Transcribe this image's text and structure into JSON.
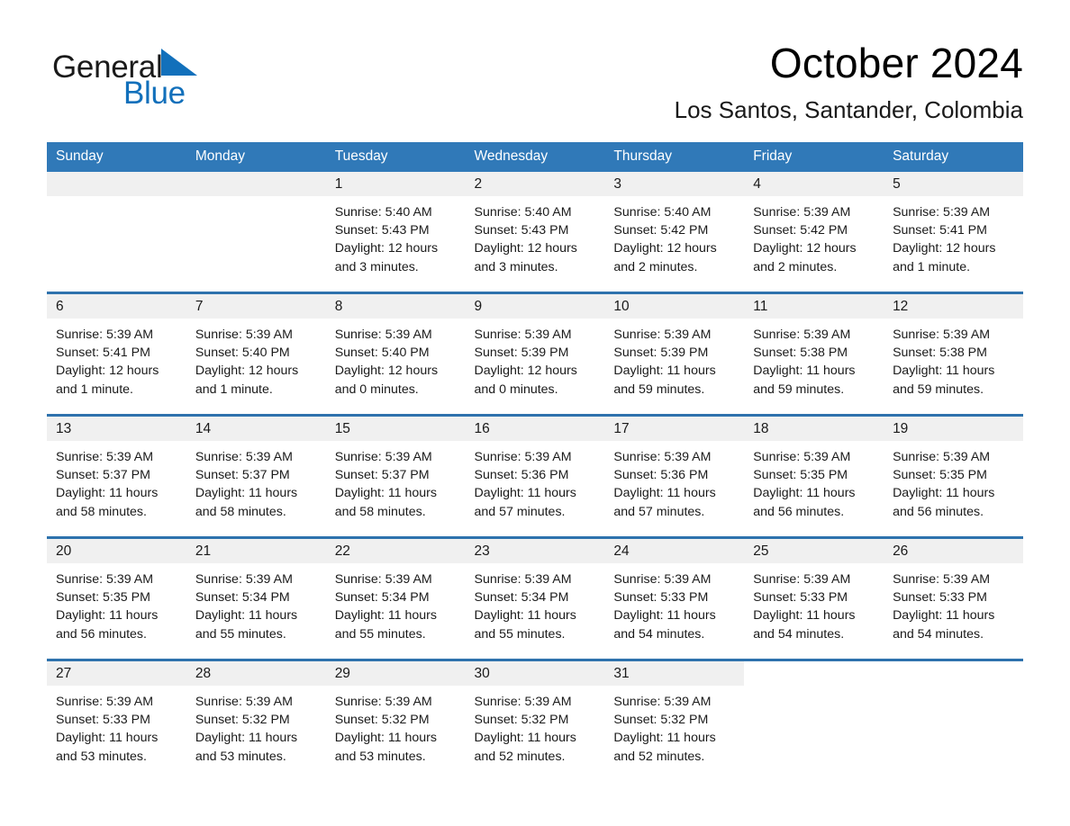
{
  "brand": {
    "word1": "General",
    "word2": "Blue",
    "flag_icon": "blue-triangle-flag",
    "accent_color": "#1270bb"
  },
  "header": {
    "month_title": "October 2024",
    "location": "Los Santos, Santander, Colombia"
  },
  "theme": {
    "header_blue": "#3079b8",
    "row_rule_blue": "#2e72ad",
    "daynum_band": "#f0f0f0"
  },
  "calendar": {
    "weekday_headers": [
      "Sunday",
      "Monday",
      "Tuesday",
      "Wednesday",
      "Thursday",
      "Friday",
      "Saturday"
    ],
    "weeks": [
      [
        {
          "day": "",
          "empty": true
        },
        {
          "day": "",
          "empty": true
        },
        {
          "day": "1",
          "sunrise": "Sunrise: 5:40 AM",
          "sunset": "Sunset: 5:43 PM",
          "daylight1": "Daylight: 12 hours",
          "daylight2": "and 3 minutes."
        },
        {
          "day": "2",
          "sunrise": "Sunrise: 5:40 AM",
          "sunset": "Sunset: 5:43 PM",
          "daylight1": "Daylight: 12 hours",
          "daylight2": "and 3 minutes."
        },
        {
          "day": "3",
          "sunrise": "Sunrise: 5:40 AM",
          "sunset": "Sunset: 5:42 PM",
          "daylight1": "Daylight: 12 hours",
          "daylight2": "and 2 minutes."
        },
        {
          "day": "4",
          "sunrise": "Sunrise: 5:39 AM",
          "sunset": "Sunset: 5:42 PM",
          "daylight1": "Daylight: 12 hours",
          "daylight2": "and 2 minutes."
        },
        {
          "day": "5",
          "sunrise": "Sunrise: 5:39 AM",
          "sunset": "Sunset: 5:41 PM",
          "daylight1": "Daylight: 12 hours",
          "daylight2": "and 1 minute."
        }
      ],
      [
        {
          "day": "6",
          "sunrise": "Sunrise: 5:39 AM",
          "sunset": "Sunset: 5:41 PM",
          "daylight1": "Daylight: 12 hours",
          "daylight2": "and 1 minute."
        },
        {
          "day": "7",
          "sunrise": "Sunrise: 5:39 AM",
          "sunset": "Sunset: 5:40 PM",
          "daylight1": "Daylight: 12 hours",
          "daylight2": "and 1 minute."
        },
        {
          "day": "8",
          "sunrise": "Sunrise: 5:39 AM",
          "sunset": "Sunset: 5:40 PM",
          "daylight1": "Daylight: 12 hours",
          "daylight2": "and 0 minutes."
        },
        {
          "day": "9",
          "sunrise": "Sunrise: 5:39 AM",
          "sunset": "Sunset: 5:39 PM",
          "daylight1": "Daylight: 12 hours",
          "daylight2": "and 0 minutes."
        },
        {
          "day": "10",
          "sunrise": "Sunrise: 5:39 AM",
          "sunset": "Sunset: 5:39 PM",
          "daylight1": "Daylight: 11 hours",
          "daylight2": "and 59 minutes."
        },
        {
          "day": "11",
          "sunrise": "Sunrise: 5:39 AM",
          "sunset": "Sunset: 5:38 PM",
          "daylight1": "Daylight: 11 hours",
          "daylight2": "and 59 minutes."
        },
        {
          "day": "12",
          "sunrise": "Sunrise: 5:39 AM",
          "sunset": "Sunset: 5:38 PM",
          "daylight1": "Daylight: 11 hours",
          "daylight2": "and 59 minutes."
        }
      ],
      [
        {
          "day": "13",
          "sunrise": "Sunrise: 5:39 AM",
          "sunset": "Sunset: 5:37 PM",
          "daylight1": "Daylight: 11 hours",
          "daylight2": "and 58 minutes."
        },
        {
          "day": "14",
          "sunrise": "Sunrise: 5:39 AM",
          "sunset": "Sunset: 5:37 PM",
          "daylight1": "Daylight: 11 hours",
          "daylight2": "and 58 minutes."
        },
        {
          "day": "15",
          "sunrise": "Sunrise: 5:39 AM",
          "sunset": "Sunset: 5:37 PM",
          "daylight1": "Daylight: 11 hours",
          "daylight2": "and 58 minutes."
        },
        {
          "day": "16",
          "sunrise": "Sunrise: 5:39 AM",
          "sunset": "Sunset: 5:36 PM",
          "daylight1": "Daylight: 11 hours",
          "daylight2": "and 57 minutes."
        },
        {
          "day": "17",
          "sunrise": "Sunrise: 5:39 AM",
          "sunset": "Sunset: 5:36 PM",
          "daylight1": "Daylight: 11 hours",
          "daylight2": "and 57 minutes."
        },
        {
          "day": "18",
          "sunrise": "Sunrise: 5:39 AM",
          "sunset": "Sunset: 5:35 PM",
          "daylight1": "Daylight: 11 hours",
          "daylight2": "and 56 minutes."
        },
        {
          "day": "19",
          "sunrise": "Sunrise: 5:39 AM",
          "sunset": "Sunset: 5:35 PM",
          "daylight1": "Daylight: 11 hours",
          "daylight2": "and 56 minutes."
        }
      ],
      [
        {
          "day": "20",
          "sunrise": "Sunrise: 5:39 AM",
          "sunset": "Sunset: 5:35 PM",
          "daylight1": "Daylight: 11 hours",
          "daylight2": "and 56 minutes."
        },
        {
          "day": "21",
          "sunrise": "Sunrise: 5:39 AM",
          "sunset": "Sunset: 5:34 PM",
          "daylight1": "Daylight: 11 hours",
          "daylight2": "and 55 minutes."
        },
        {
          "day": "22",
          "sunrise": "Sunrise: 5:39 AM",
          "sunset": "Sunset: 5:34 PM",
          "daylight1": "Daylight: 11 hours",
          "daylight2": "and 55 minutes."
        },
        {
          "day": "23",
          "sunrise": "Sunrise: 5:39 AM",
          "sunset": "Sunset: 5:34 PM",
          "daylight1": "Daylight: 11 hours",
          "daylight2": "and 55 minutes."
        },
        {
          "day": "24",
          "sunrise": "Sunrise: 5:39 AM",
          "sunset": "Sunset: 5:33 PM",
          "daylight1": "Daylight: 11 hours",
          "daylight2": "and 54 minutes."
        },
        {
          "day": "25",
          "sunrise": "Sunrise: 5:39 AM",
          "sunset": "Sunset: 5:33 PM",
          "daylight1": "Daylight: 11 hours",
          "daylight2": "and 54 minutes."
        },
        {
          "day": "26",
          "sunrise": "Sunrise: 5:39 AM",
          "sunset": "Sunset: 5:33 PM",
          "daylight1": "Daylight: 11 hours",
          "daylight2": "and 54 minutes."
        }
      ],
      [
        {
          "day": "27",
          "sunrise": "Sunrise: 5:39 AM",
          "sunset": "Sunset: 5:33 PM",
          "daylight1": "Daylight: 11 hours",
          "daylight2": "and 53 minutes."
        },
        {
          "day": "28",
          "sunrise": "Sunrise: 5:39 AM",
          "sunset": "Sunset: 5:32 PM",
          "daylight1": "Daylight: 11 hours",
          "daylight2": "and 53 minutes."
        },
        {
          "day": "29",
          "sunrise": "Sunrise: 5:39 AM",
          "sunset": "Sunset: 5:32 PM",
          "daylight1": "Daylight: 11 hours",
          "daylight2": "and 53 minutes."
        },
        {
          "day": "30",
          "sunrise": "Sunrise: 5:39 AM",
          "sunset": "Sunset: 5:32 PM",
          "daylight1": "Daylight: 11 hours",
          "daylight2": "and 52 minutes."
        },
        {
          "day": "31",
          "sunrise": "Sunrise: 5:39 AM",
          "sunset": "Sunset: 5:32 PM",
          "daylight1": "Daylight: 11 hours",
          "daylight2": "and 52 minutes."
        },
        {
          "day": "",
          "empty": true
        },
        {
          "day": "",
          "empty": true
        }
      ]
    ]
  }
}
